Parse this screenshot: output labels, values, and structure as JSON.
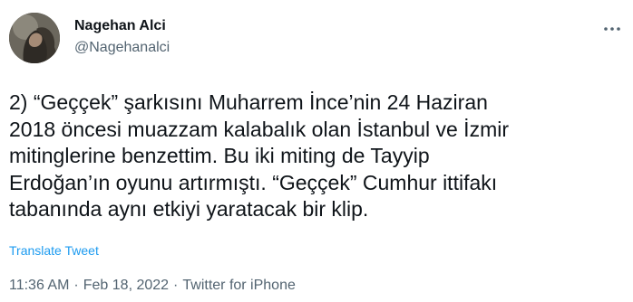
{
  "author": {
    "display_name": "Nagehan Alci",
    "handle": "@Nagehanalci"
  },
  "tweet": {
    "lines": [
      "2)  “Geççek” şarkısını Muharrem İnce’nin 24 Haziran",
      "2018 öncesi muazzam kalabalık olan İstanbul ve İzmir",
      "mitinglerine benzettim. Bu iki miting de Tayyip",
      "Erdoğan’ın oyunu artırmıştı. “Geççek” Cumhur ittifakı",
      "tabanında aynı etkiyi yaratacak bir klip."
    ],
    "translate_label": "Translate Tweet"
  },
  "meta": {
    "time": "11:36 AM",
    "separator": "·",
    "date": "Feb 18, 2022",
    "source": "Twitter for iPhone"
  },
  "icons": {
    "more": "more-horizontal-icon"
  },
  "colors": {
    "text": "#0f1419",
    "secondary": "#536471",
    "link": "#1d9bf0"
  }
}
